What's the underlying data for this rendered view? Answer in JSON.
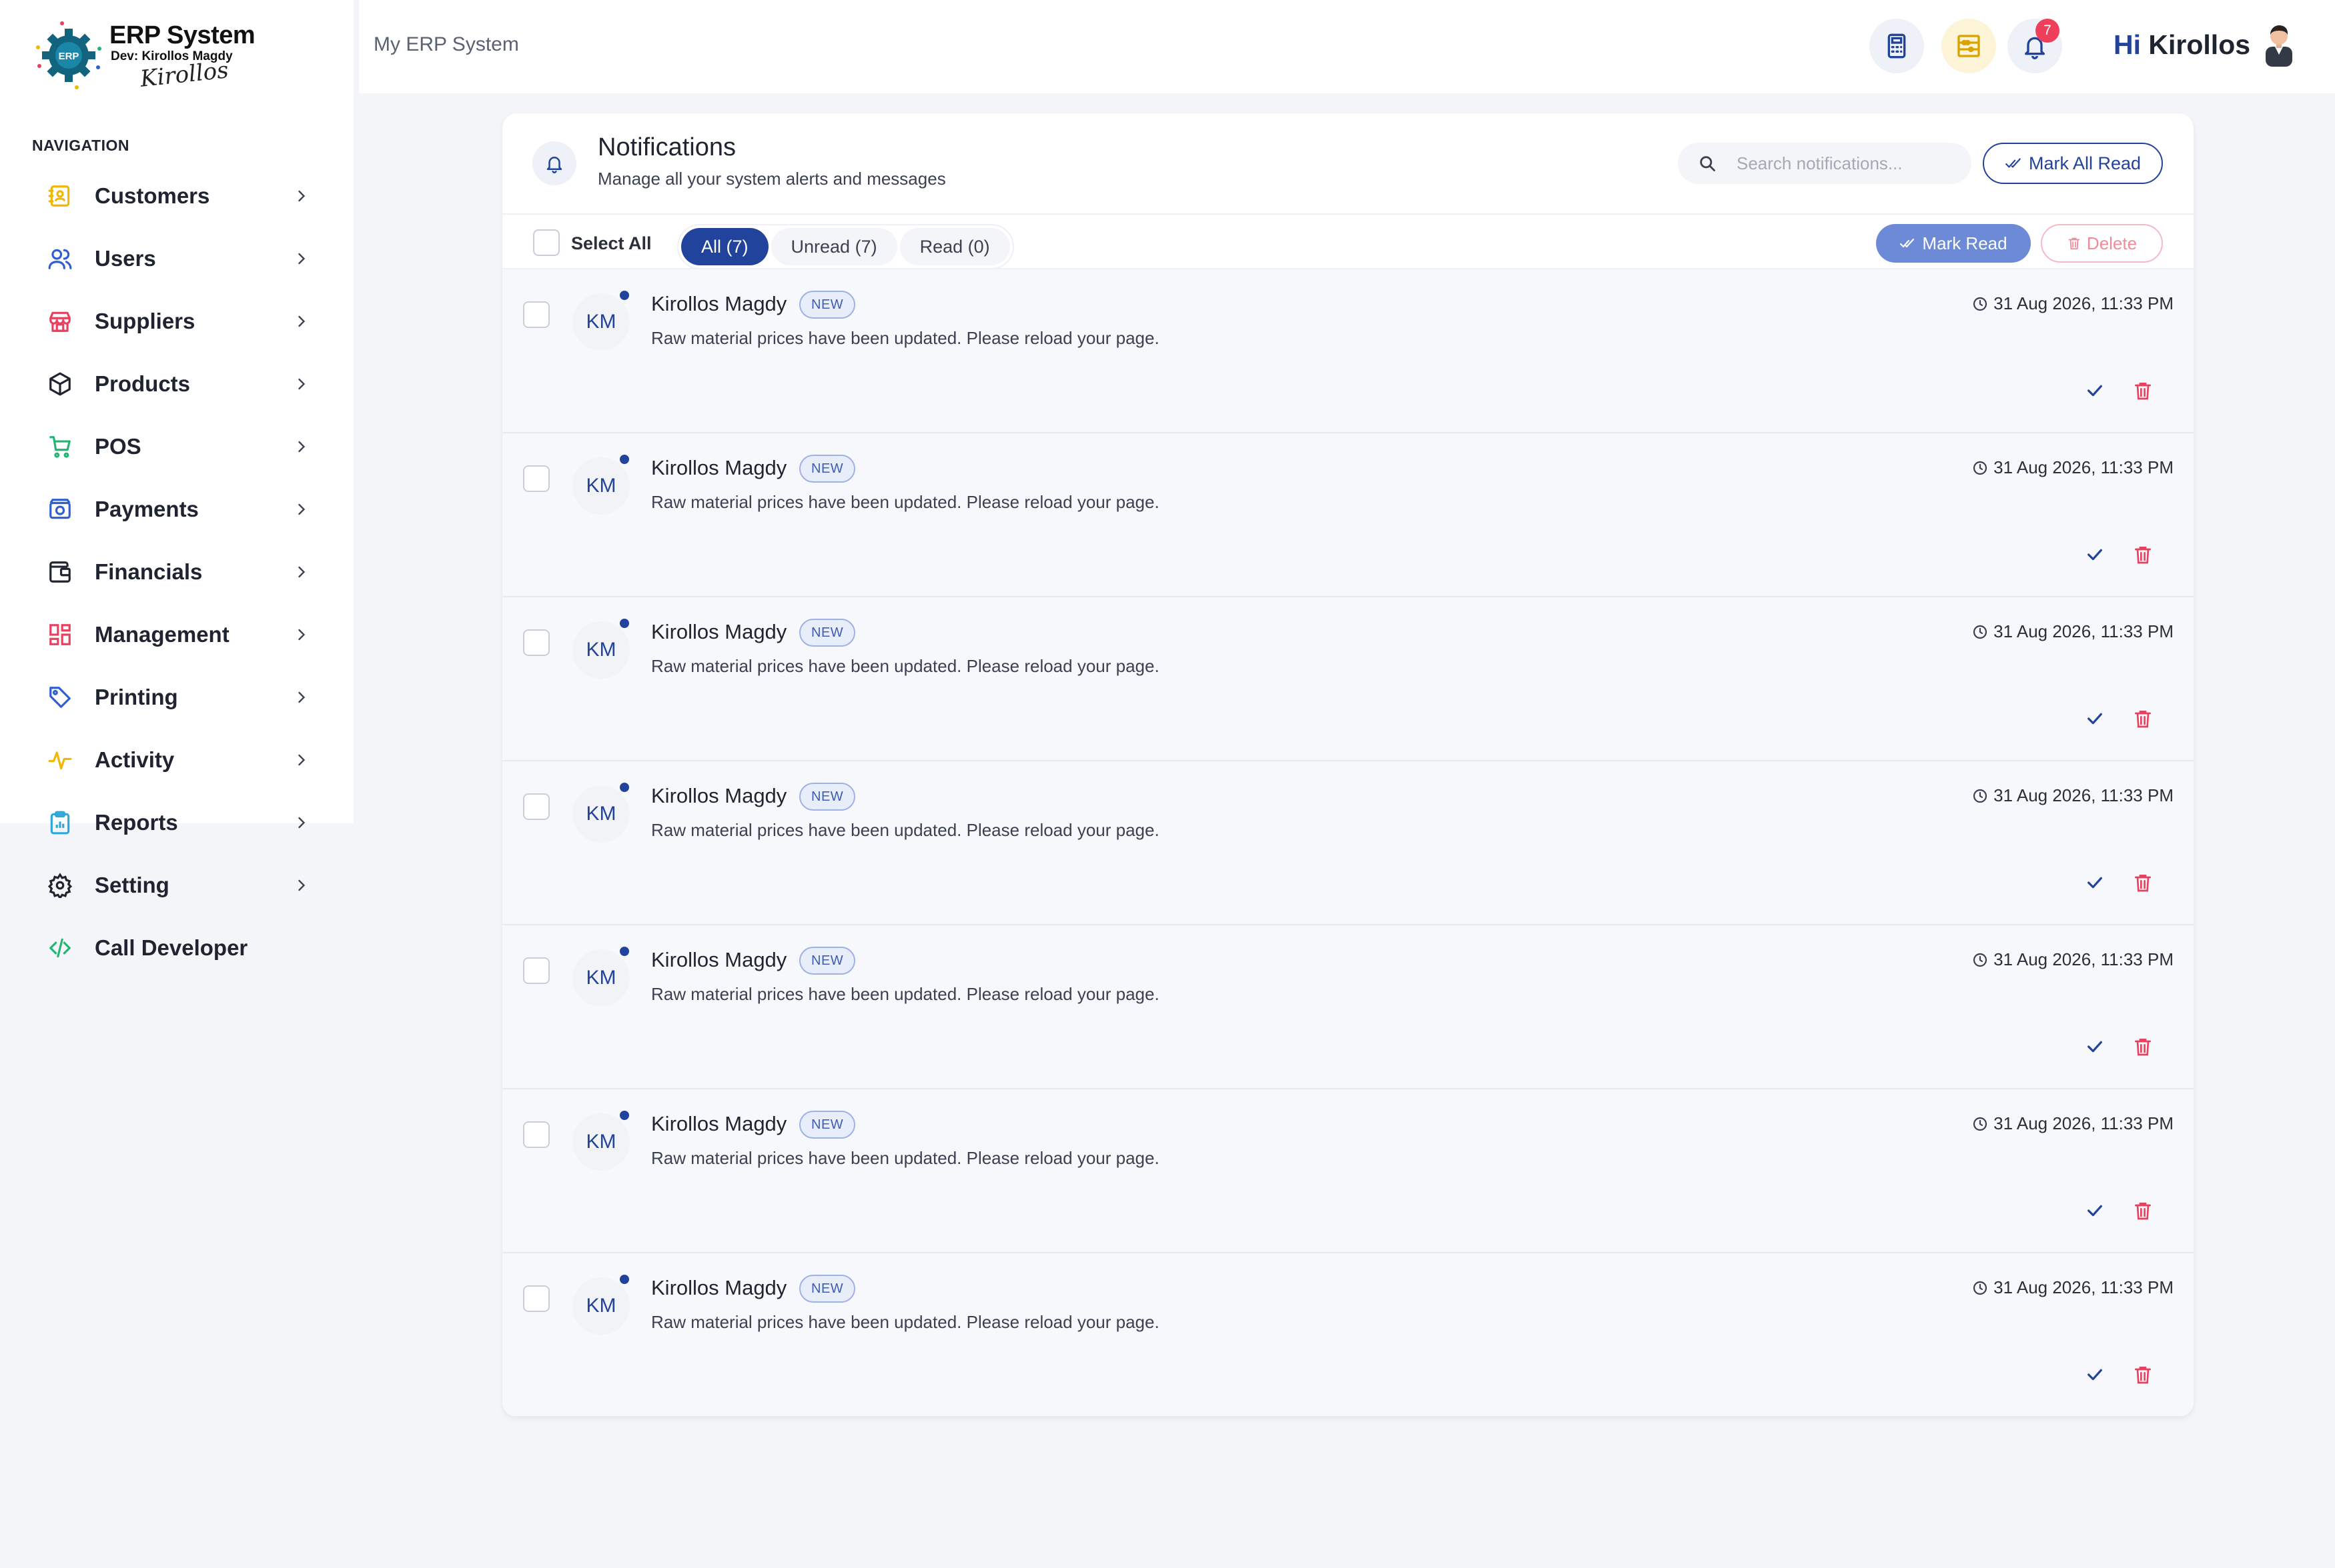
{
  "brand": {
    "title": "ERP System",
    "dev": "Dev: Kirollos Magdy",
    "signature": "Kirollos",
    "logo_text": "ERP"
  },
  "sidebar": {
    "heading": "NAVIGATION",
    "items": [
      {
        "label": "Customers",
        "icon": "customers-icon",
        "color": "#f2b705",
        "has_chevron": true
      },
      {
        "label": "Users",
        "icon": "users-icon",
        "color": "#2f5fd0",
        "has_chevron": true
      },
      {
        "label": "Suppliers",
        "icon": "store-icon",
        "color": "#e8405f",
        "has_chevron": true
      },
      {
        "label": "Products",
        "icon": "box-icon",
        "color": "#1f2430",
        "has_chevron": true
      },
      {
        "label": "POS",
        "icon": "cart-icon",
        "color": "#22b573",
        "has_chevron": true
      },
      {
        "label": "Payments",
        "icon": "wallet-camera-icon",
        "color": "#2f5fd0",
        "has_chevron": true
      },
      {
        "label": "Financials",
        "icon": "wallet-icon",
        "color": "#1f2430",
        "has_chevron": true
      },
      {
        "label": "Management",
        "icon": "dashboard-icon",
        "color": "#e8405f",
        "has_chevron": true
      },
      {
        "label": "Printing",
        "icon": "tag-icon",
        "color": "#2f5fd0",
        "has_chevron": true
      },
      {
        "label": "Activity",
        "icon": "pulse-icon",
        "color": "#f2b705",
        "has_chevron": true
      },
      {
        "label": "Reports",
        "icon": "clipboard-chart-icon",
        "color": "#2fa8d8",
        "has_chevron": true
      },
      {
        "label": "Setting",
        "icon": "gear-icon",
        "color": "#1f2430",
        "has_chevron": true
      },
      {
        "label": "Call Developer",
        "icon": "code-icon",
        "color": "#22b573",
        "has_chevron": false
      }
    ]
  },
  "topbar": {
    "app_name": "My ERP System",
    "notification_count": "7",
    "greeting_hi": "Hi",
    "greeting_name": "Kirollos"
  },
  "notifications": {
    "title": "Notifications",
    "subtitle": "Manage all your system alerts and messages",
    "search_placeholder": "Search notifications...",
    "mark_all_label": "Mark All Read",
    "select_all_label": "Select All",
    "tabs": [
      {
        "label": "All (7)",
        "active": true
      },
      {
        "label": "Unread (7)",
        "active": false
      },
      {
        "label": "Read (0)",
        "active": false
      }
    ],
    "mark_read_label": "Mark Read",
    "delete_label": "Delete",
    "items": [
      {
        "initials": "KM",
        "name": "Kirollos Magdy",
        "badge": "NEW",
        "message": "Raw material prices have been updated. Please reload your page.",
        "time": "31 Aug 2026, 11:33 PM"
      },
      {
        "initials": "KM",
        "name": "Kirollos Magdy",
        "badge": "NEW",
        "message": "Raw material prices have been updated. Please reload your page.",
        "time": "31 Aug 2026, 11:33 PM"
      },
      {
        "initials": "KM",
        "name": "Kirollos Magdy",
        "badge": "NEW",
        "message": "Raw material prices have been updated. Please reload your page.",
        "time": "31 Aug 2026, 11:33 PM"
      },
      {
        "initials": "KM",
        "name": "Kirollos Magdy",
        "badge": "NEW",
        "message": "Raw material prices have been updated. Please reload your page.",
        "time": "31 Aug 2026, 11:33 PM"
      },
      {
        "initials": "KM",
        "name": "Kirollos Magdy",
        "badge": "NEW",
        "message": "Raw material prices have been updated. Please reload your page.",
        "time": "31 Aug 2026, 11:33 PM"
      },
      {
        "initials": "KM",
        "name": "Kirollos Magdy",
        "badge": "NEW",
        "message": "Raw material prices have been updated. Please reload your page.",
        "time": "31 Aug 2026, 11:33 PM"
      },
      {
        "initials": "KM",
        "name": "Kirollos Magdy",
        "badge": "NEW",
        "message": "Raw material prices have been updated. Please reload your page.",
        "time": "31 Aug 2026, 11:33 PM"
      }
    ]
  },
  "colors": {
    "primary": "#22439b",
    "danger": "#e8405f",
    "background": "#f4f5f8"
  }
}
